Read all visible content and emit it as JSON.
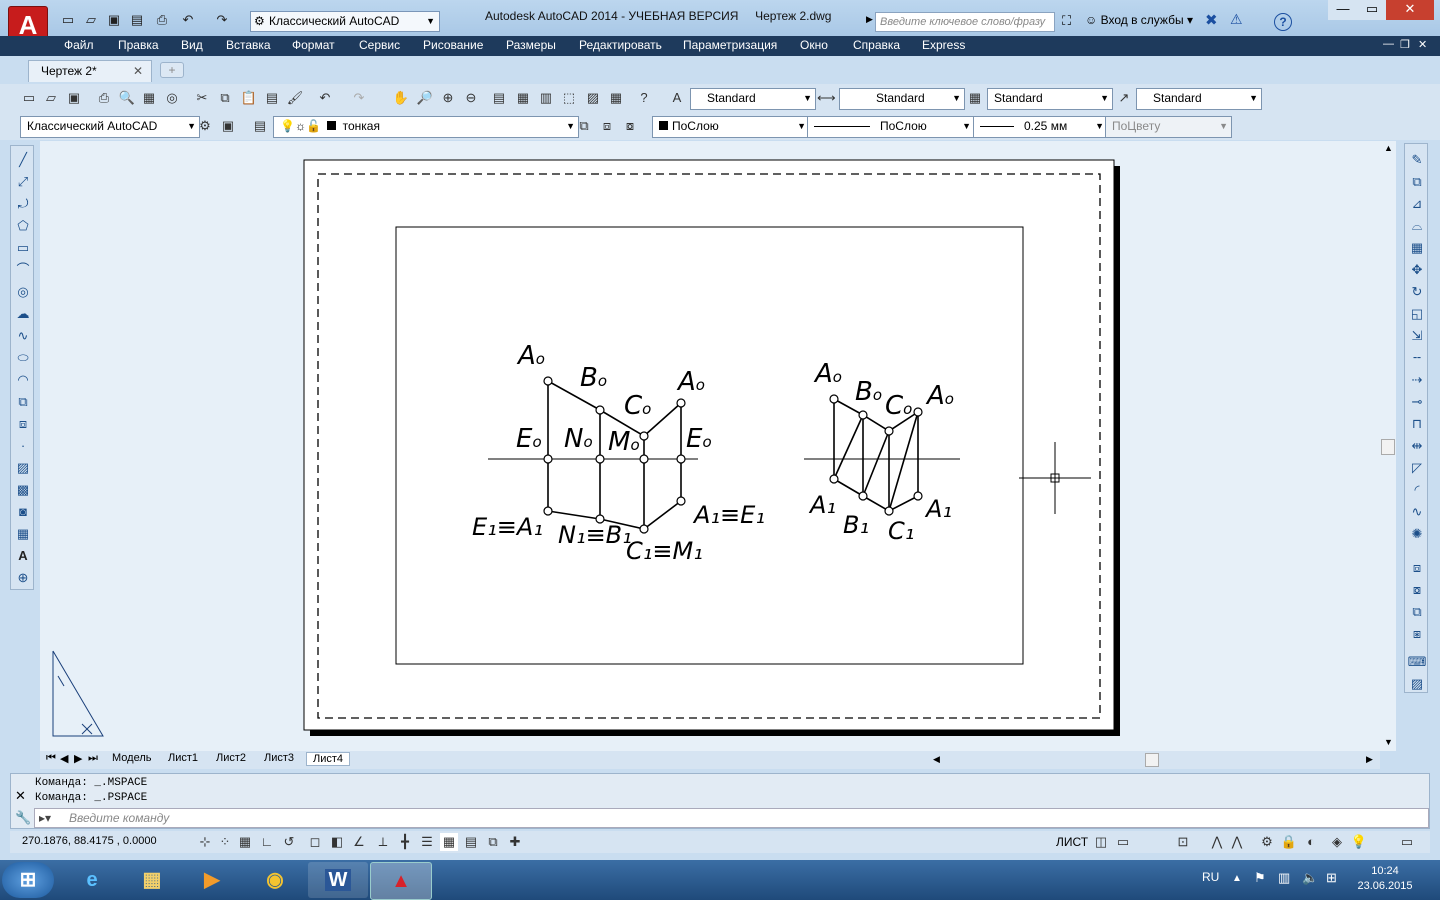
{
  "titlebar": {
    "logo": "A",
    "workspace": "Классический AutoCAD",
    "app_title": "Autodesk AutoCAD 2014 - УЧЕБНАЯ ВЕРСИЯ",
    "file_name": "Чертеж 2.dwg",
    "search_placeholder": "Введите ключевое слово/фразу",
    "login": "Вход в службы",
    "help": "?"
  },
  "menu": [
    "Файл",
    "Правка",
    "Вид",
    "Вставка",
    "Формат",
    "Сервис",
    "Рисование",
    "Размеры",
    "Редактировать",
    "Параметризация",
    "Окно",
    "Справка",
    "Express"
  ],
  "doc_tab": {
    "label": "Чертеж 2*",
    "close": "✕"
  },
  "styles": {
    "text": "Standard",
    "dim": "Standard",
    "table": "Standard",
    "mleader": "Standard"
  },
  "props": {
    "workspace": "Классический AutoCAD",
    "layer": "тонкая",
    "color": "ПоСлою",
    "linetype": "ПоСлою",
    "lineweight": "0.25 мм",
    "plotstyle": "ПоЦвету"
  },
  "layout_tabs": [
    "Модель",
    "Лист1",
    "Лист2",
    "Лист3",
    "Лист4"
  ],
  "command": {
    "line1": "Команда:  _.MSPACE",
    "line2": "Команда:  _.PSPACE",
    "placeholder": "Введите команду"
  },
  "status": {
    "coords": "270.1876, 88.4175 , 0.0000",
    "space": "ЛИСТ"
  },
  "taskbar": {
    "lang": "RU",
    "time": "10:24",
    "date": "23.06.2015"
  },
  "drawing_labels": {
    "left": {
      "a0_tl": "A",
      "b0": "B",
      "c0": "C",
      "a0_tr": "A",
      "e0_l": "E",
      "n0": "N",
      "m0": "M",
      "e0_r": "E",
      "e1a1": "E₁≡A₁",
      "n1b1": "N₁≡B₁",
      "c1m1": "C₁≡M₁",
      "a1e1": "A₁≡E₁"
    },
    "right": {
      "a0_l": "A",
      "b0": "B",
      "c0": "C",
      "a0_r": "A",
      "a1_l": "A₁",
      "b1": "B₁",
      "c1": "C₁",
      "a1_r": "A₁"
    },
    "sub0": "o"
  }
}
